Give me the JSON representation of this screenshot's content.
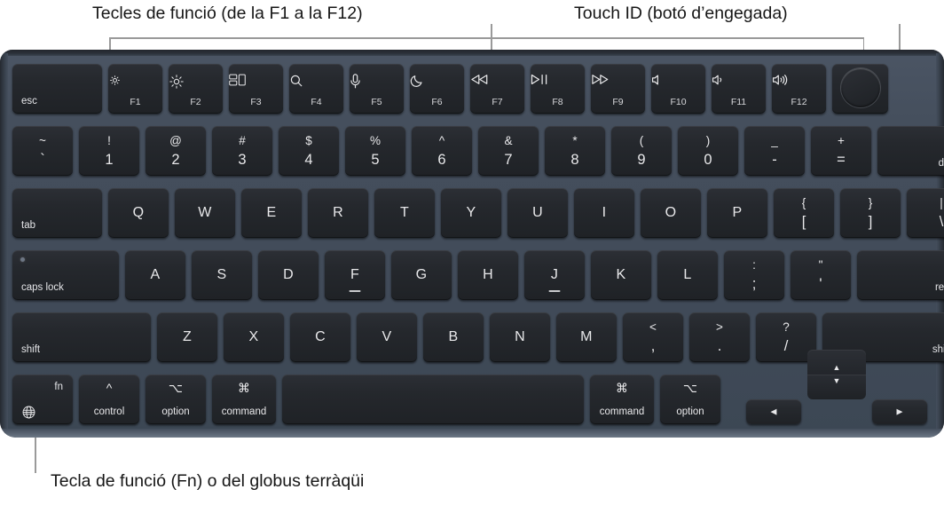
{
  "callouts": {
    "function_keys": "Tecles de funció (de la F1 a la F12)",
    "touch_id": "Touch ID (botó d’engegada)",
    "fn_globe": "Tecla de funció (Fn) o del globus terràqüi"
  },
  "colors": {
    "page_background": "#ffffff",
    "chassis": "#454f5d",
    "key_face": "#25282d",
    "legend": "#e8e8ea",
    "callout_text": "#161616",
    "leader_line": "#9a9a9a"
  },
  "keyboard": {
    "rows": [
      {
        "name": "function-row",
        "keys": [
          {
            "name": "esc",
            "legend_corner": "esc"
          },
          {
            "name": "f1",
            "icon": "brightness-down-icon",
            "fnum": "F1"
          },
          {
            "name": "f2",
            "icon": "brightness-up-icon",
            "fnum": "F2"
          },
          {
            "name": "f3",
            "icon": "mission-control-icon",
            "fnum": "F3"
          },
          {
            "name": "f4",
            "icon": "spotlight-search-icon",
            "fnum": "F4"
          },
          {
            "name": "f5",
            "icon": "dictation-mic-icon",
            "fnum": "F5"
          },
          {
            "name": "f6",
            "icon": "do-not-disturb-moon-icon",
            "fnum": "F6"
          },
          {
            "name": "f7",
            "icon": "rewind-icon",
            "fnum": "F7"
          },
          {
            "name": "f8",
            "icon": "play-pause-icon",
            "fnum": "F8"
          },
          {
            "name": "f9",
            "icon": "fast-forward-icon",
            "fnum": "F9"
          },
          {
            "name": "f10",
            "icon": "volume-mute-icon",
            "fnum": "F10"
          },
          {
            "name": "f11",
            "icon": "volume-down-icon",
            "fnum": "F11"
          },
          {
            "name": "f12",
            "icon": "volume-up-icon",
            "fnum": "F12"
          },
          {
            "name": "touch-id",
            "icon": "touch-id-icon"
          }
        ]
      },
      {
        "name": "number-row",
        "keys": [
          {
            "name": "grave",
            "upper": "~",
            "lower": "`"
          },
          {
            "name": "one",
            "upper": "!",
            "lower": "1"
          },
          {
            "name": "two",
            "upper": "@",
            "lower": "2"
          },
          {
            "name": "three",
            "upper": "#",
            "lower": "3"
          },
          {
            "name": "four",
            "upper": "$",
            "lower": "4"
          },
          {
            "name": "five",
            "upper": "%",
            "lower": "5"
          },
          {
            "name": "six",
            "upper": "^",
            "lower": "6"
          },
          {
            "name": "seven",
            "upper": "&",
            "lower": "7"
          },
          {
            "name": "eight",
            "upper": "*",
            "lower": "8"
          },
          {
            "name": "nine",
            "upper": "(",
            "lower": "9"
          },
          {
            "name": "zero",
            "upper": ")",
            "lower": "0"
          },
          {
            "name": "minus",
            "upper": "_",
            "lower": "-"
          },
          {
            "name": "equal",
            "upper": "+",
            "lower": "="
          },
          {
            "name": "delete",
            "legend_corner": "delete"
          }
        ]
      },
      {
        "name": "top-letter-row",
        "keys": [
          {
            "name": "tab",
            "legend_corner": "tab"
          },
          {
            "name": "q",
            "center": "Q"
          },
          {
            "name": "w",
            "center": "W"
          },
          {
            "name": "e",
            "center": "E"
          },
          {
            "name": "r",
            "center": "R"
          },
          {
            "name": "t",
            "center": "T"
          },
          {
            "name": "y",
            "center": "Y"
          },
          {
            "name": "u",
            "center": "U"
          },
          {
            "name": "i",
            "center": "I"
          },
          {
            "name": "o",
            "center": "O"
          },
          {
            "name": "p",
            "center": "P"
          },
          {
            "name": "bracket-left",
            "upper": "{",
            "lower": "["
          },
          {
            "name": "bracket-right",
            "upper": "}",
            "lower": "]"
          },
          {
            "name": "backslash",
            "upper": "|",
            "lower": "\\"
          }
        ]
      },
      {
        "name": "home-row",
        "keys": [
          {
            "name": "caps-lock",
            "legend_corner": "caps lock",
            "led": true
          },
          {
            "name": "a",
            "center": "A"
          },
          {
            "name": "s",
            "center": "S"
          },
          {
            "name": "d",
            "center": "D"
          },
          {
            "name": "f",
            "center": "F",
            "homing": true
          },
          {
            "name": "g",
            "center": "G"
          },
          {
            "name": "h",
            "center": "H"
          },
          {
            "name": "j",
            "center": "J",
            "homing": true
          },
          {
            "name": "k",
            "center": "K"
          },
          {
            "name": "l",
            "center": "L"
          },
          {
            "name": "semicolon",
            "upper": ":",
            "lower": ";"
          },
          {
            "name": "quote",
            "upper": "\"",
            "lower": "'"
          },
          {
            "name": "return",
            "legend_corner": "return"
          }
        ]
      },
      {
        "name": "bottom-letter-row",
        "keys": [
          {
            "name": "shift-left",
            "legend_corner": "shift"
          },
          {
            "name": "z",
            "center": "Z"
          },
          {
            "name": "x",
            "center": "X"
          },
          {
            "name": "c",
            "center": "C"
          },
          {
            "name": "v",
            "center": "V"
          },
          {
            "name": "b",
            "center": "B"
          },
          {
            "name": "n",
            "center": "N"
          },
          {
            "name": "m",
            "center": "M"
          },
          {
            "name": "comma",
            "upper": "<",
            "lower": ","
          },
          {
            "name": "period",
            "upper": ">",
            "lower": "."
          },
          {
            "name": "slash",
            "upper": "?",
            "lower": "/"
          },
          {
            "name": "shift-right",
            "legend_corner": "shift"
          }
        ]
      },
      {
        "name": "modifier-row",
        "keys": [
          {
            "name": "fn",
            "corner_top": "fn",
            "icon": "globe-icon"
          },
          {
            "name": "control-left",
            "glyph": "^",
            "word": "control"
          },
          {
            "name": "option-left",
            "glyph": "⌥",
            "word": "option"
          },
          {
            "name": "command-left",
            "glyph": "⌘",
            "word": "command"
          },
          {
            "name": "space"
          },
          {
            "name": "command-right",
            "glyph": "⌘",
            "word": "command"
          },
          {
            "name": "option-right",
            "glyph": "⌥",
            "word": "option"
          },
          {
            "name": "arrow-left",
            "icon": "arrow-left-icon"
          },
          {
            "name": "arrow-up",
            "icon": "arrow-up-icon"
          },
          {
            "name": "arrow-down",
            "icon": "arrow-down-icon"
          },
          {
            "name": "arrow-right",
            "icon": "arrow-right-icon"
          }
        ]
      }
    ]
  }
}
